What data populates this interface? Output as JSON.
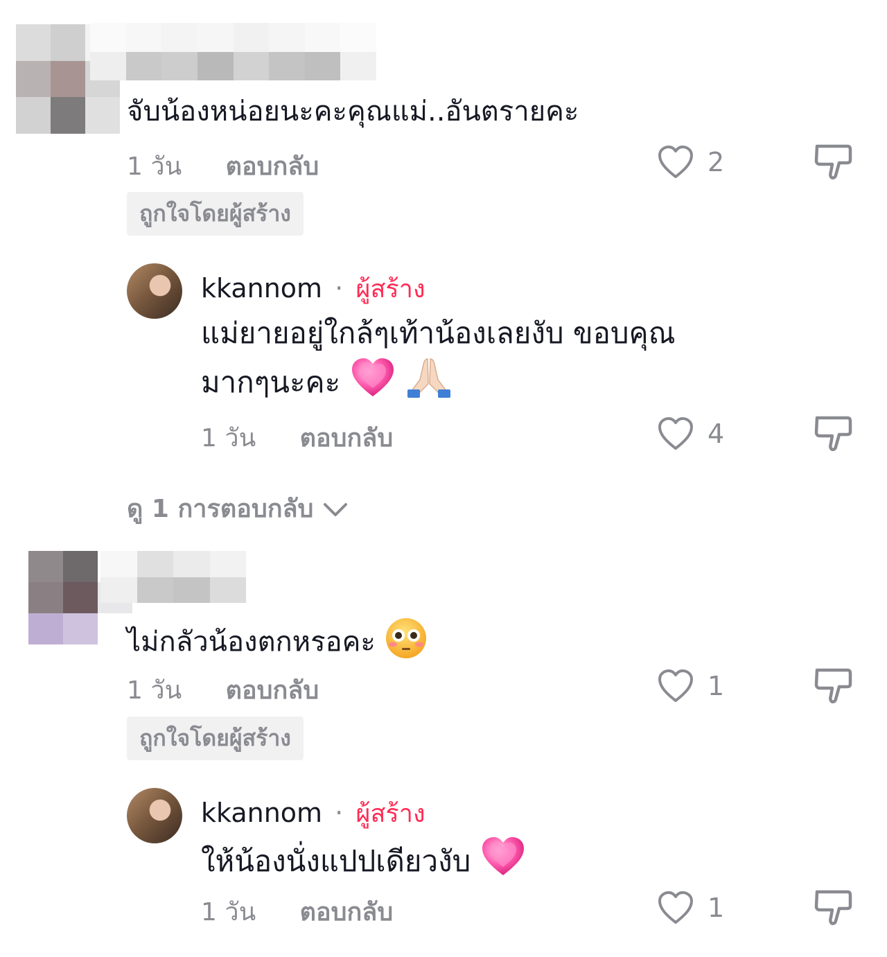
{
  "comments": [
    {
      "text": "จับน้องหน่อยนะคะคุณแม่..อันตรายคะ",
      "time": "1 วัน",
      "reply_label": "ตอบกลับ",
      "likes": "2",
      "badge": "ถูกใจโดยผู้สร้าง",
      "reply": {
        "username": "kkannom",
        "separator": "·",
        "creator_label": "ผู้สร้าง",
        "text_line1": "แม่ยายอยู่ใกล้ๆเท้าน้องเลยงับ ขอบคุณ",
        "text_line2": "มากๆนะคะ",
        "time": "1 วัน",
        "reply_label": "ตอบกลับ",
        "likes": "4"
      },
      "view_replies": "ดู 1 การตอบกลับ"
    },
    {
      "text": "ไม่กลัวน้องตกหรอคะ",
      "time": "1 วัน",
      "reply_label": "ตอบกลับ",
      "likes": "1",
      "badge": "ถูกใจโดยผู้สร้าง",
      "reply": {
        "username": "kkannom",
        "separator": "·",
        "creator_label": "ผู้สร้าง",
        "text_line1": "ให้น้องนั่งแปปเดียวงับ",
        "time": "1 วัน",
        "reply_label": "ตอบกลับ",
        "likes": "1"
      }
    }
  ],
  "icons": {
    "like": "heart-outline-icon",
    "dislike": "thumbs-down-icon",
    "expand": "chevron-down-icon"
  },
  "colors": {
    "creator": "#fe2c55",
    "muted": "#8a8b91",
    "text": "#161823",
    "badge_bg": "#f1f1f2"
  }
}
